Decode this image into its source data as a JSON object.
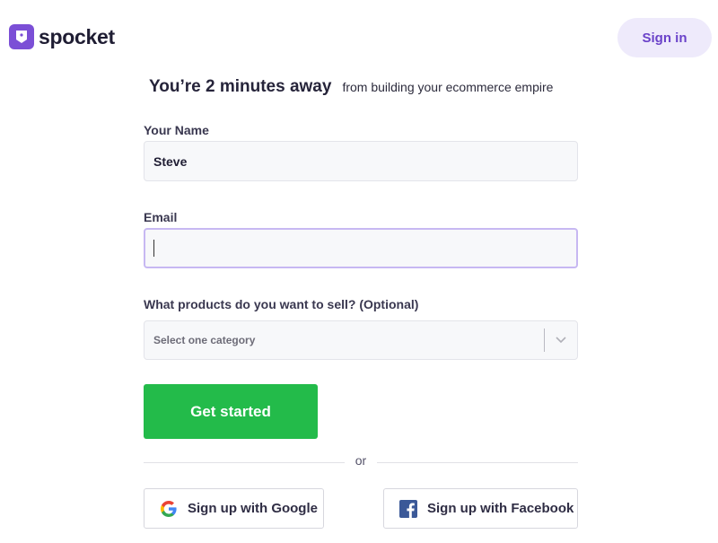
{
  "brand": {
    "name": "spocket",
    "accent_color": "#7b4fd6"
  },
  "header": {
    "signin_label": "Sign in"
  },
  "headline": {
    "main": "You’re 2 minutes away",
    "sub": "from building your ecommerce empire"
  },
  "form": {
    "name_label": "Your Name",
    "name_value": "Steve",
    "email_label": "Email",
    "email_value": "",
    "products_label": "What products do you want to sell? (Optional)",
    "products_placeholder": "Select one category",
    "submit_label": "Get started",
    "submit_color": "#23bb4a"
  },
  "divider": {
    "text": "or"
  },
  "social": {
    "google_label": "Sign up with Google",
    "google_icon": "google-icon",
    "facebook_label": "Sign up with Facebook",
    "facebook_icon": "facebook-icon"
  }
}
